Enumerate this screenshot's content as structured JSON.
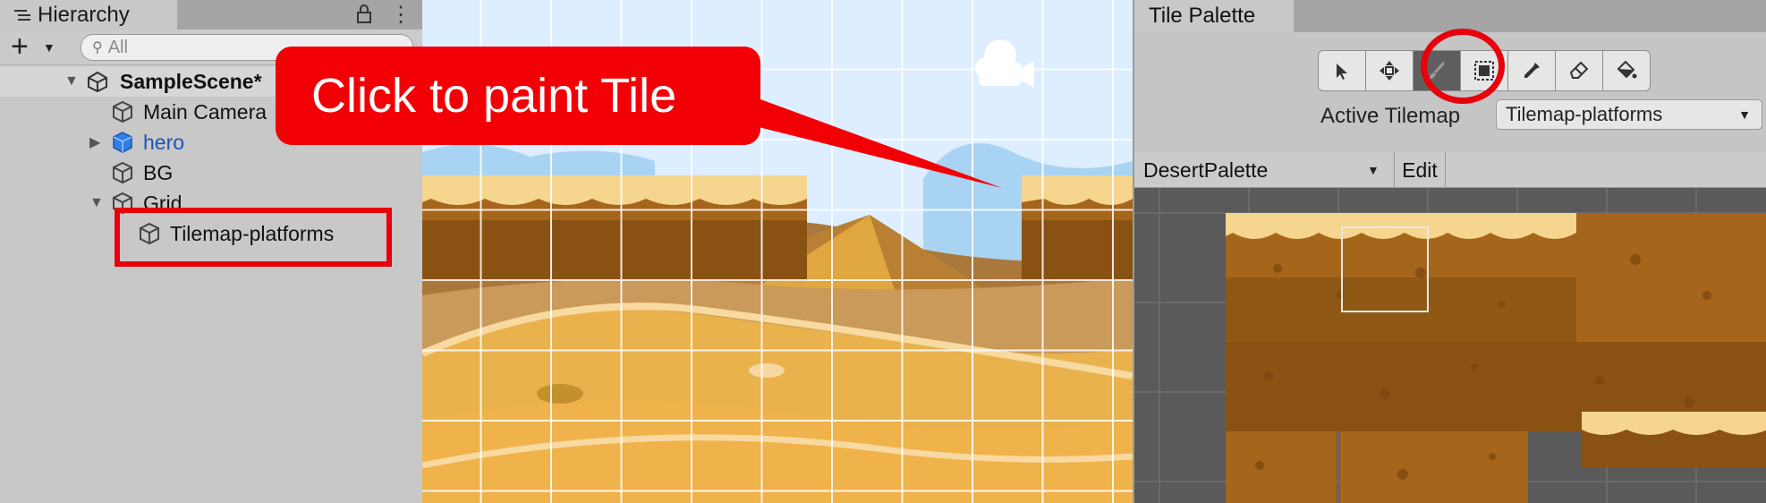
{
  "hierarchy": {
    "tab_title": "Hierarchy",
    "search_placeholder": "All",
    "add_label": "+",
    "scene_name": "SampleScene*",
    "items": [
      {
        "label": "Main Camera"
      },
      {
        "label": "hero"
      },
      {
        "label": "BG"
      },
      {
        "label": "Grid"
      },
      {
        "label": "Tilemap-platforms"
      }
    ]
  },
  "callout": {
    "text": "Click to paint Tile"
  },
  "palette": {
    "tab_title": "Tile Palette",
    "tools": [
      "select-tool-icon",
      "move-tool-icon",
      "paintbrush-icon",
      "box-fill-icon",
      "eyedropper-icon",
      "eraser-icon",
      "paint-bucket-icon"
    ],
    "active_tool": "paintbrush-icon",
    "active_tilemap_label": "Active Tilemap",
    "active_tilemap_value": "Tilemap-platforms",
    "palette_name": "DesertPalette",
    "edit_label": "Edit"
  },
  "colors": {
    "highlight_red": "#e8000b",
    "hero_blue": "#1a53b8",
    "sand_light": "#f6d58e",
    "dirt_brown": "#a5651b"
  }
}
